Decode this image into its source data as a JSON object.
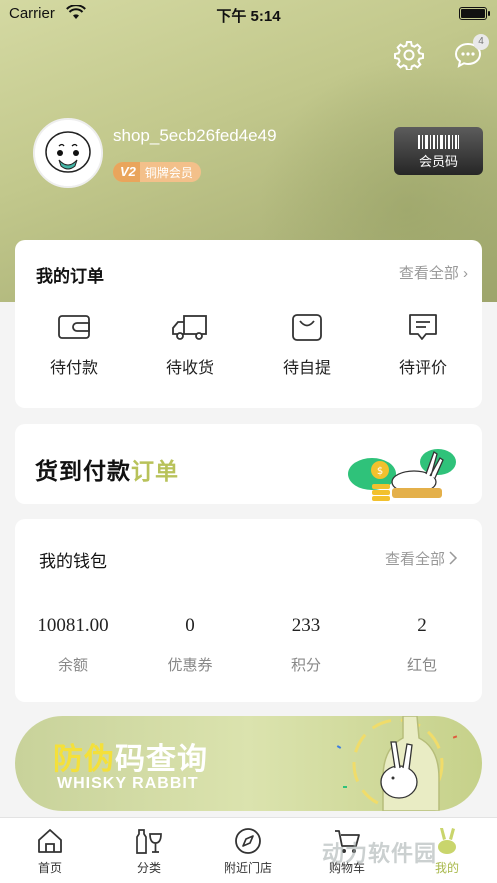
{
  "status_bar": {
    "carrier": "Carrier",
    "time": "下午 5:14"
  },
  "header": {
    "message_badge": "4"
  },
  "profile": {
    "username": "shop_5ecb26fed4e49",
    "level": "V2",
    "tier": "铜牌会员",
    "member_code_label": "会员码"
  },
  "orders": {
    "title": "我的订单",
    "see_all": "查看全部 ›",
    "items": [
      {
        "label": "待付款",
        "icon": "wallet-icon"
      },
      {
        "label": "待收货",
        "icon": "truck-icon"
      },
      {
        "label": "待自提",
        "icon": "bag-icon"
      },
      {
        "label": "待评价",
        "icon": "comment-icon"
      }
    ]
  },
  "cod": {
    "title_main": "货到付款",
    "title_highlight": "订单"
  },
  "wallet": {
    "title": "我的钱包",
    "see_all": "查看全部",
    "items": [
      {
        "value": "10081.00",
        "label": "余额"
      },
      {
        "value": "0",
        "label": "优惠券"
      },
      {
        "value": "233",
        "label": "积分"
      },
      {
        "value": "2",
        "label": "红包"
      }
    ]
  },
  "banner": {
    "title_part1": "防伪",
    "title_part2": "码查询",
    "subtitle": "WHISKY RABBIT"
  },
  "tabbar": {
    "items": [
      {
        "label": "首页",
        "icon": "home-icon"
      },
      {
        "label": "分类",
        "icon": "glass-icon"
      },
      {
        "label": "附近门店",
        "icon": "compass-icon"
      },
      {
        "label": "购物车",
        "icon": "cart-icon"
      },
      {
        "label": "我的",
        "icon": "rabbit-icon"
      }
    ],
    "active_index": 4
  },
  "watermark": "动力软件园",
  "colors": {
    "accent": "#a8b84a",
    "hero_bg": "#c2c88c",
    "badge": "#e9a55c"
  }
}
